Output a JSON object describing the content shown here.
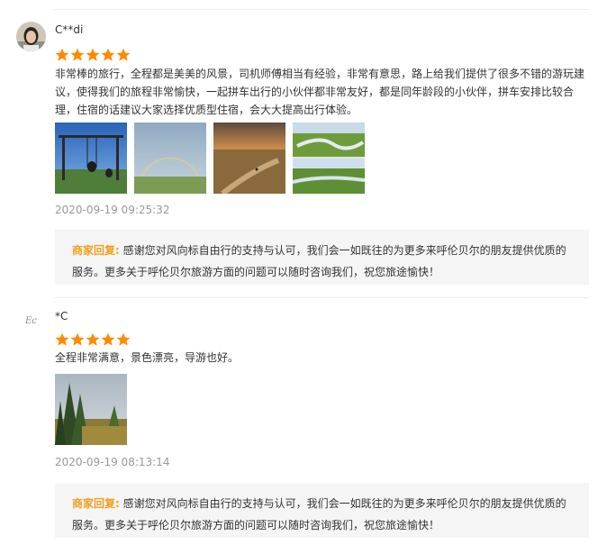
{
  "reviews": [
    {
      "username": "C**di",
      "rating": 5,
      "text": "非常棒的旅行，全程都是美美的风景，司机师傅相当有经验，非常有意思，路上给我们提供了很多不错的游玩建议，使得我们的旅程非常愉快，一起拼车出行的小伙伴都非常友好，都是同年龄段的小伙伴，拼车安排比较合理，住宿的话建议大家选择优质型住宿，会大大提高出行体验。",
      "photos": [
        "swing-photo",
        "rainbow-photo",
        "sunset-road-photo",
        "river-photo"
      ],
      "timestamp": "2020-09-19 09:25:32",
      "reply_label": "商家回复:",
      "reply_text": "感谢您对风向标自由行的支持与认可，我们会一如既往的为更多来呼伦贝尔的朋友提供优质的服务。更多关于呼伦贝尔旅游方面的问题可以随时咨询我们，祝您旅途愉快！"
    },
    {
      "username": "*C",
      "avatar_text": "Ec",
      "rating": 5,
      "text": "全程非常满意，景色漂亮，导游也好。",
      "photos": [
        "forest-photo"
      ],
      "timestamp": "2020-09-19 08:13:14",
      "reply_label": "商家回复:",
      "reply_text": "感谢您对风向标自由行的支持与认可，我们会一如既往的为更多来呼伦贝尔的朋友提供优质的服务。更多关于呼伦贝尔旅游方面的问题可以随时咨询我们，祝您旅途愉快！"
    }
  ],
  "colors": {
    "star": "#ff8a00",
    "reply_label": "#f0a020",
    "timestamp": "#999999",
    "reply_bg": "#f5f5f5"
  }
}
